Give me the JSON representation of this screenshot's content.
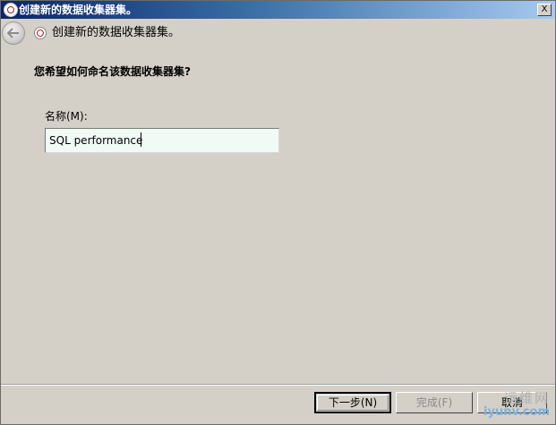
{
  "window": {
    "title": "创建新的数据收集器集。",
    "close_glyph": "X"
  },
  "nav": {
    "title": "创建新的数据收集器集。"
  },
  "content": {
    "question": "您希望如何命名该数据收集器集?",
    "name_label": "名称(M):",
    "name_value": "SQL performance"
  },
  "buttons": {
    "next": "下一步(N)",
    "finish": "完成(F)",
    "cancel": "取消"
  },
  "watermark": {
    "cn": "运维网",
    "en": "iyunv.com"
  },
  "colors": {
    "window_bg": "#d4d0c8",
    "input_bg": "#f1fbf6",
    "title_gradient_start": "#0a246a"
  }
}
